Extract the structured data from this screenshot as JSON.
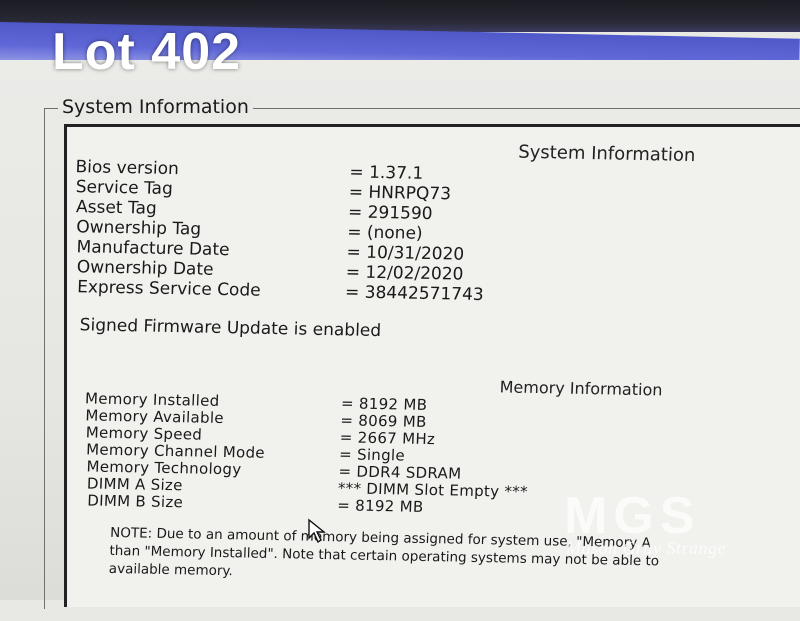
{
  "overlay": {
    "lot_label": "Lot 402"
  },
  "group": {
    "title": "System Information"
  },
  "system": {
    "header": "System Information",
    "rows": [
      {
        "label": "Bios version",
        "value": "= 1.37.1"
      },
      {
        "label": "Service Tag",
        "value": "= HNRPQ73"
      },
      {
        "label": "Asset Tag",
        "value": "= 291590"
      },
      {
        "label": "Ownership Tag",
        "value": "= (none)"
      },
      {
        "label": "Manufacture Date",
        "value": "= 10/31/2020"
      },
      {
        "label": "Ownership Date",
        "value": "= 12/02/2020"
      },
      {
        "label": "Express Service Code",
        "value": "= 38442571743"
      }
    ],
    "firmware_status": "Signed Firmware Update is enabled"
  },
  "memory": {
    "header": "Memory Information",
    "rows": [
      {
        "label": "Memory Installed",
        "value": "= 8192 MB"
      },
      {
        "label": "Memory Available",
        "value": "= 8069 MB"
      },
      {
        "label": "Memory Speed",
        "value": "= 2667 MHz"
      },
      {
        "label": "Memory Channel Mode",
        "value": "= Single"
      },
      {
        "label": "Memory Technology",
        "value": "= DDR4 SDRAM"
      },
      {
        "label": "DIMM A Size",
        "value": "*** DIMM Slot Empty ***"
      },
      {
        "label": "DIMM B Size",
        "value": "= 8192 MB"
      }
    ],
    "note_lines": [
      "NOTE: Due to an amount of memory being assigned for system use, \"Memory A",
      "than \"Memory Installed\". Note that certain operating systems may not be able to",
      "available memory."
    ]
  },
  "watermark": {
    "logo_text": "MGS",
    "tagline": "Mason Gray Strange"
  },
  "colors": {
    "band_blue": "#5860d0",
    "screen": "#ebebe8",
    "text": "#1a1a1a"
  },
  "icons": {
    "cursor": "arrow-cursor-icon"
  }
}
